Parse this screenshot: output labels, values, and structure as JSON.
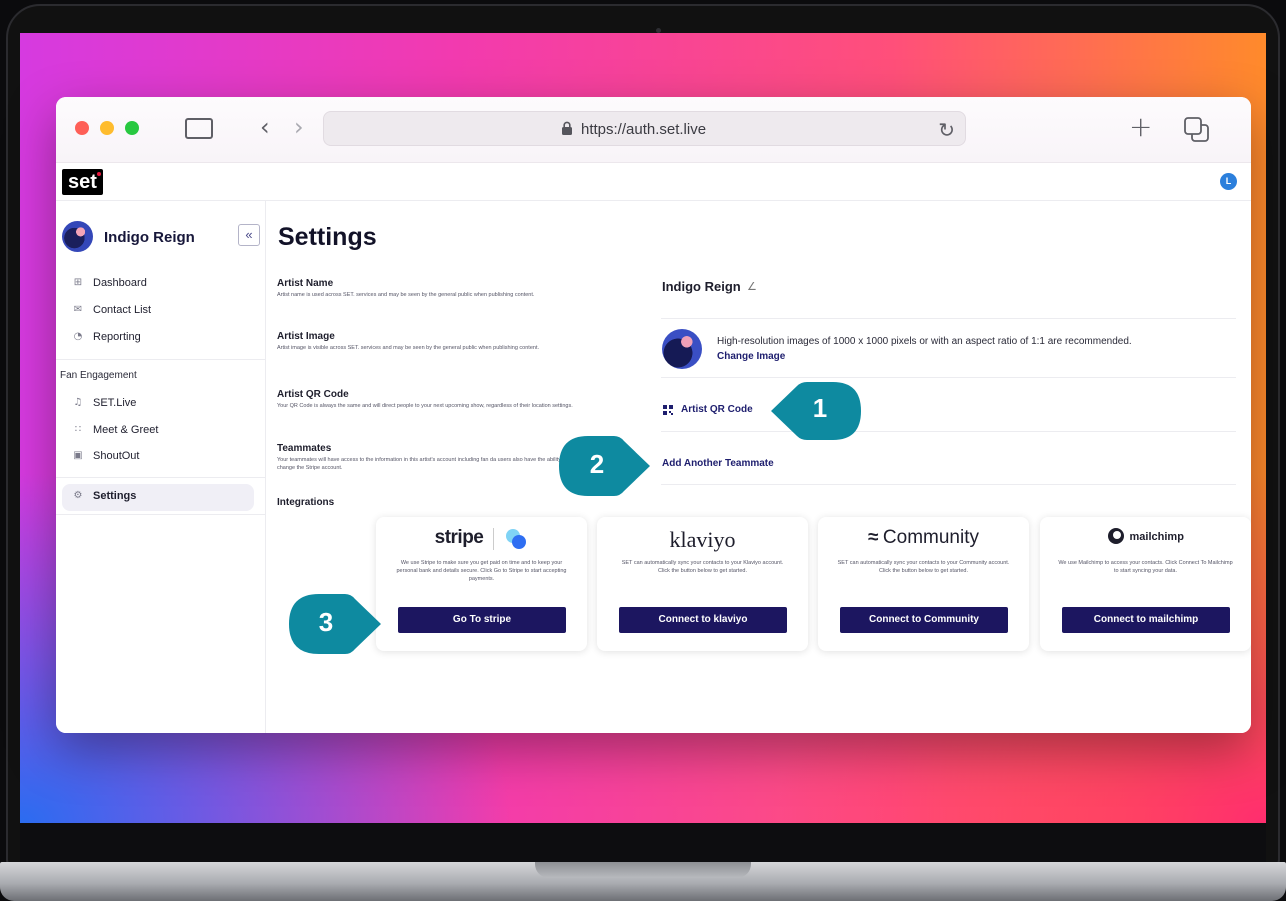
{
  "browser": {
    "url": "https://auth.set.live"
  },
  "app": {
    "logo": "set",
    "user_initial": "L"
  },
  "sidebar": {
    "artist_name": "Indigo Reign",
    "collapse_glyph": "«",
    "items": [
      {
        "label": "Dashboard",
        "icon": "grid-icon"
      },
      {
        "label": "Contact List",
        "icon": "mail-icon"
      },
      {
        "label": "Reporting",
        "icon": "chart-icon"
      }
    ],
    "section_label": "Fan Engagement",
    "fan_items": [
      {
        "label": "SET.Live",
        "icon": "music-note-icon"
      },
      {
        "label": "Meet & Greet",
        "icon": "people-icon"
      },
      {
        "label": "ShoutOut",
        "icon": "video-icon"
      }
    ],
    "settings_label": "Settings"
  },
  "main": {
    "title": "Settings",
    "artist_name": {
      "label": "Artist Name",
      "desc": "Artist name is used across SET. services and may be seen by the general public when publishing content.",
      "value": "Indigo Reign"
    },
    "artist_image": {
      "label": "Artist Image",
      "desc": "Artist image is visible across SET. services and may be seen by the general public when publishing content.",
      "hint": "High-resolution images of 1000 x 1000 pixels or with an aspect ratio of 1:1 are recommended.",
      "action": "Change Image"
    },
    "qr_code": {
      "label": "Artist QR Code",
      "desc": "Your QR Code is always the same and will direct people to your next upcoming show, regardless of their location settings.",
      "action": "Artist QR Code"
    },
    "teammates": {
      "label": "Teammates",
      "desc": "Your teammates will have access to the information in this artist's account including fan da users also have the ability to change the Stripe account.",
      "action": "Add Another Teammate"
    },
    "integrations_label": "Integrations",
    "integrations": [
      {
        "logo": "stripe",
        "desc": "We use Stripe to make sure you get paid on time and to keep your personal bank and details secure. Click Go to Stripe to start accepting payments.",
        "button": "Go To stripe"
      },
      {
        "logo": "klaviyo",
        "desc": "SET can automatically sync your contacts to your Klaviyo account. Click the button below to get started.",
        "button": "Connect to klaviyo"
      },
      {
        "logo": "Community",
        "desc": "SET can automatically sync your contacts to your Community account. Click the button below to get started.",
        "button": "Connect to Community"
      },
      {
        "logo": "mailchimp",
        "desc": "We use Mailchimp to access your contacts. Click Connect To Mailchimp to start syncing your data.",
        "button": "Connect to mailchimp"
      }
    ]
  },
  "callouts": [
    "1",
    "2",
    "3"
  ],
  "colors": {
    "primary_button": "#1c1660",
    "callout": "#0e8aa0",
    "link": "#1e1e6e"
  }
}
